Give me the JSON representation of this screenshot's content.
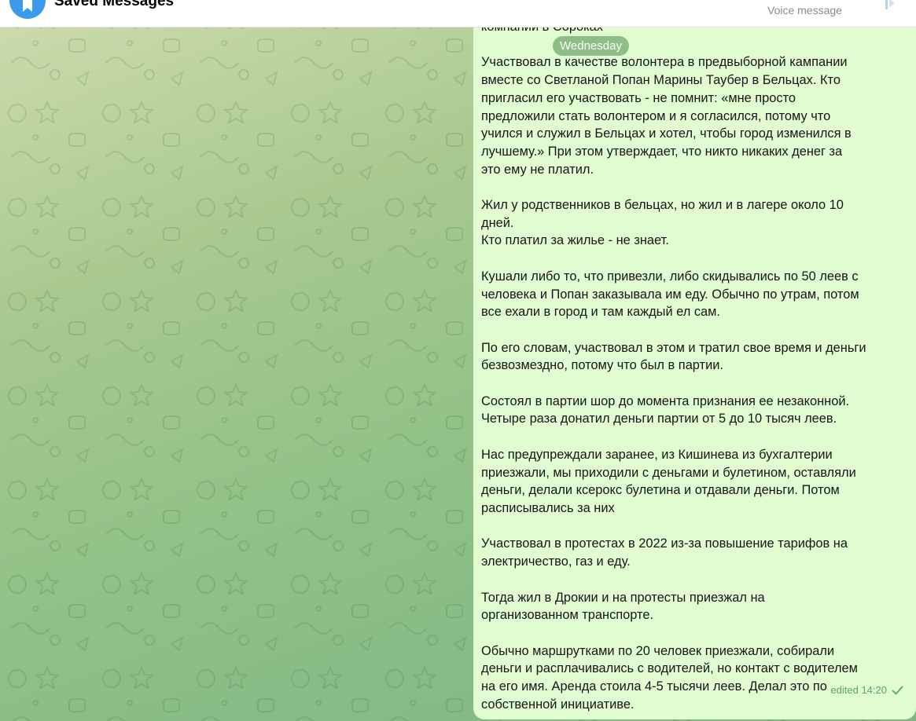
{
  "header": {
    "title": "Saved Messages",
    "pinned_subtitle": "Voice message",
    "avatar_icon": "bookmark-icon",
    "accent_color": "#3a9bea"
  },
  "date_separator": "Wednesday",
  "message": {
    "lines": [
      "компании в Сороках",
      "",
      "Участвовал в качестве волонтера в предвыборной кампании",
      "вместе со Светланой Попан Марины Таубер в Бельцах. Кто",
      "пригласил его участвовать - не помнит: «мне просто",
      "предложили стать волонтером и я согласился, потому что",
      "учился и служил в Бельцах и хотел, чтобы город изменился в",
      "лучшему.» При этом утверждает, что никто никаких денег за",
      "это ему не платил.",
      "",
      "Жил у родственников в бельцах, но жил и в лагере около 10",
      "дней.",
      "Кто платил за жилье - не знает.",
      "",
      "Кушали либо то, что привезли, либо скидывались по 50 леев с",
      "человека и Попан заказывала им еду. Обычно по утрам, потом",
      "все ехали в город и там каждый ел сам.",
      "",
      "По его словам, участвовал в этом и тратил свое время и деньги",
      "безвозмездно, потому что был в партии.",
      "",
      "Состоял в партии шор до момента признания ее незаконной.",
      "Четыре раза донатил деньги партии от 5 до 10 тысяч леев.",
      "",
      "Нас предупреждали заранее, из Кишинева из бухгалтерии",
      "приезжали, мы приходили с деньгами и булетином, оставляли",
      "деньги, делали ксерокс булетина и отдавали деньги. Потом",
      "расписывались за них",
      "",
      "Участвовал в протестах в 2022 из-за повышение тарифов на",
      "электричество, газ и еду.",
      "",
      "Тогда жил в Дрокии и на протесты приезжал на",
      "организованном транспорте.",
      "",
      "Обычно маршрутками по 20 человек приезжали, собирали",
      "деньги и расплачивались с водителей, но контакт с водителем",
      "на его имя. Аренда стоила 4-5 тысячи леев. Делал это по",
      "собственной инициативе."
    ],
    "status": "edited 14:20",
    "read_icon": "check-icon",
    "bubble_color": "#e2fcd2",
    "meta_color": "#5da55a"
  }
}
